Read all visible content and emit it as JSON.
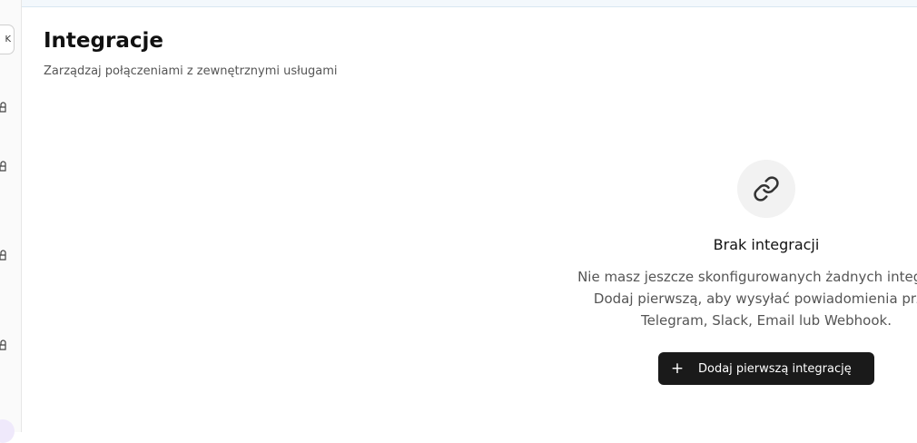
{
  "sidebar": {
    "collapse_label": "K",
    "icons": [
      "lock-icon",
      "lock-icon",
      "lock-icon",
      "lock-icon"
    ]
  },
  "header": {
    "title": "Integracje",
    "subtitle": "Zarządzaj połączeniami z zewnętrznymi usługami"
  },
  "empty_state": {
    "icon": "link-icon",
    "title": "Brak integracji",
    "description": "Nie masz jeszcze skonfigurowanych żadnych integracji.\nDodaj pierwszą, aby wysyłać powiadomienia przez\nTelegram, Slack, Email lub Webhook.",
    "button_icon": "+",
    "button_label": "Dodaj pierwszą integrację"
  },
  "colors": {
    "primary_button": "#1a1a1a",
    "topbar": "#f3f8fc"
  }
}
